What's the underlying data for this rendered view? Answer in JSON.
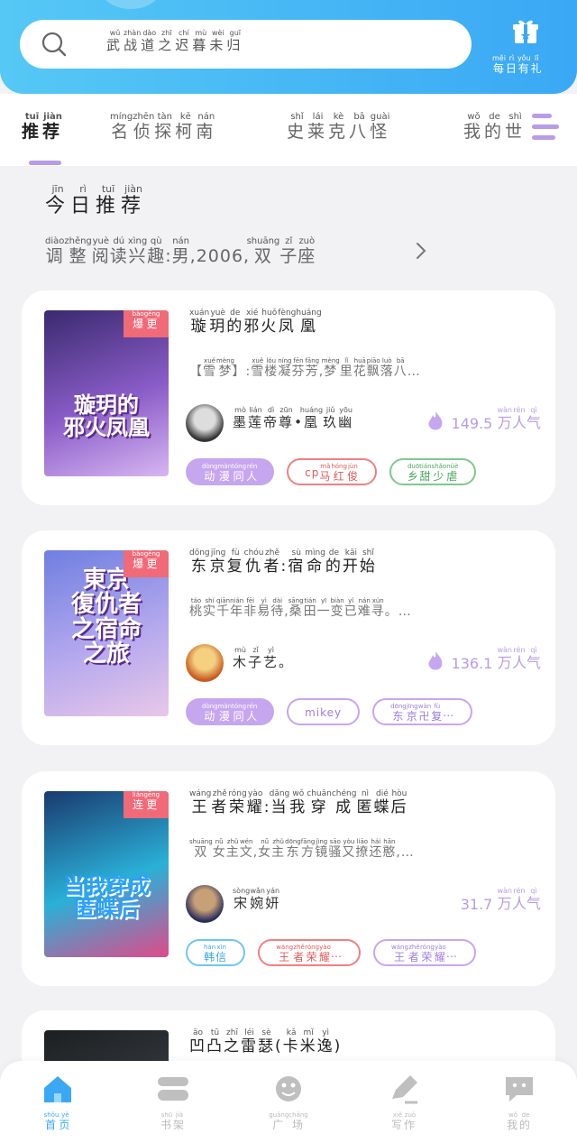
{
  "search": {
    "placeholder": [
      [
        "武",
        "wǔ"
      ],
      [
        "战",
        "zhàn"
      ],
      [
        "道",
        "dào"
      ],
      [
        "之",
        "zhī"
      ],
      [
        "迟",
        "chí"
      ],
      [
        "暮",
        "mù"
      ],
      [
        "未",
        "wèi"
      ],
      [
        "归",
        "guī"
      ]
    ]
  },
  "gift": {
    "label": [
      [
        "每",
        "měi"
      ],
      [
        "日",
        "rì"
      ],
      [
        "有",
        "yǒu"
      ],
      [
        "礼",
        "lǐ"
      ]
    ]
  },
  "tabs": [
    {
      "chars": [
        [
          "推",
          "tuī"
        ],
        [
          "荐",
          "jiàn"
        ]
      ],
      "active": true
    },
    {
      "chars": [
        [
          "名",
          "míng"
        ],
        [
          "侦",
          "zhēn"
        ],
        [
          "探",
          "tàn"
        ],
        [
          "柯",
          "kē"
        ],
        [
          "南",
          "nán"
        ]
      ],
      "active": false
    },
    {
      "chars": [
        [
          "史",
          "shǐ"
        ],
        [
          "莱",
          "lái"
        ],
        [
          "克",
          "kè"
        ],
        [
          "八",
          "bā"
        ],
        [
          "怪",
          "guài"
        ]
      ],
      "active": false
    },
    {
      "chars": [
        [
          "我",
          "wǒ"
        ],
        [
          "的",
          "de"
        ],
        [
          "世",
          "shì"
        ]
      ],
      "active": false
    }
  ],
  "recommend": {
    "title": [
      [
        "今",
        "jīn"
      ],
      [
        "日",
        "rì"
      ],
      [
        "推",
        "tuī"
      ],
      [
        "荐",
        "jiàn"
      ]
    ],
    "subtitle": [
      [
        "调",
        "diào"
      ],
      [
        "整",
        "zhěng"
      ],
      [
        "阅",
        "yuè"
      ],
      [
        "读",
        "dú"
      ],
      [
        "兴",
        "xìng"
      ],
      [
        "趣",
        "qù"
      ],
      [
        ":",
        ""
      ],
      [
        "男",
        "nán"
      ],
      [
        ",",
        ""
      ],
      [
        "2006",
        ""
      ],
      [
        ",",
        ""
      ],
      [
        "双",
        "shuāng"
      ],
      [
        "子",
        "zǐ"
      ],
      [
        "座",
        "zuò"
      ]
    ]
  },
  "books": [
    {
      "badge": [
        [
          "爆",
          "bào"
        ],
        [
          "更",
          "gēng"
        ]
      ],
      "cover_text": "璇玥的\n邪火凤凰",
      "title": [
        [
          "璇",
          "xuán"
        ],
        [
          "玥",
          "yuè"
        ],
        [
          "的",
          "de"
        ],
        [
          "邪",
          "xié"
        ],
        [
          "火",
          "huǒ"
        ],
        [
          "凤",
          "fèng"
        ],
        [
          "凰",
          "huáng"
        ]
      ],
      "desc": [
        [
          "【",
          ""
        ],
        [
          "雪",
          "xuě"
        ],
        [
          "梦",
          "mèng"
        ],
        [
          "】",
          ""
        ],
        [
          ":",
          ""
        ],
        [
          "雪",
          "xuě"
        ],
        [
          "楼",
          "lóu"
        ],
        [
          "凝",
          "níng"
        ],
        [
          "芬",
          "fēn"
        ],
        [
          "芳",
          "fāng"
        ],
        [
          ",",
          ""
        ],
        [
          "梦",
          "mèng"
        ],
        [
          "里",
          "lǐ"
        ],
        [
          "花",
          "huā"
        ],
        [
          "飘",
          "piāo"
        ],
        [
          "落",
          "luò"
        ],
        [
          "八",
          "bā"
        ],
        [
          "…",
          ""
        ]
      ],
      "author": [
        [
          "墨",
          "mò"
        ],
        [
          "莲",
          "lián"
        ],
        [
          "帝",
          "dì"
        ],
        [
          "尊",
          "zūn"
        ],
        [
          "•",
          ""
        ],
        [
          "凰",
          "huáng"
        ],
        [
          "玖",
          "jiǔ"
        ],
        [
          "幽",
          "yōu"
        ]
      ],
      "popularity_num": "149.5",
      "popularity_unit": [
        [
          "万",
          "wàn"
        ],
        [
          "人",
          "rén"
        ],
        [
          "气",
          "qì"
        ]
      ],
      "hot": true,
      "tags": [
        {
          "style": "purple-fill",
          "chars": [
            [
              "动",
              "dòng"
            ],
            [
              "漫",
              "màn"
            ],
            [
              "同",
              "tóng"
            ],
            [
              "人",
              "rén"
            ]
          ]
        },
        {
          "style": "red",
          "chars": [
            [
              "cp",
              ""
            ],
            [
              "马",
              "mǎ"
            ],
            [
              "红",
              "hóng"
            ],
            [
              "俊",
              "jùn"
            ]
          ]
        },
        {
          "style": "green",
          "chars": [
            [
              "乡",
              "duō"
            ],
            [
              "甜",
              "tián"
            ],
            [
              "少",
              "shǎo"
            ],
            [
              "虐",
              "nüè"
            ]
          ]
        }
      ],
      "colors": [
        "#3a2a6e",
        "#8a5cc8",
        "#d7b6f2"
      ]
    },
    {
      "badge": [
        [
          "爆",
          "bào"
        ],
        [
          "更",
          "gēng"
        ]
      ],
      "cover_text": "東京\n復仇者\n之宿命\n之旅",
      "title": [
        [
          "东",
          "dōng"
        ],
        [
          "京",
          "jīng"
        ],
        [
          "复",
          "fù"
        ],
        [
          "仇",
          "chóu"
        ],
        [
          "者",
          "zhě"
        ],
        [
          ":",
          ""
        ],
        [
          "宿",
          "sù"
        ],
        [
          "命",
          "mìng"
        ],
        [
          "的",
          "de"
        ],
        [
          "开",
          "kāi"
        ],
        [
          "始",
          "shǐ"
        ]
      ],
      "desc": [
        [
          "桃",
          "táo"
        ],
        [
          "实",
          "shí"
        ],
        [
          "千",
          "qiān"
        ],
        [
          "年",
          "nián"
        ],
        [
          "非",
          "fēi"
        ],
        [
          "易",
          "yì"
        ],
        [
          "待",
          "dài"
        ],
        [
          ",",
          ""
        ],
        [
          "桑",
          "sāng"
        ],
        [
          "田",
          "tián"
        ],
        [
          "一",
          "yī"
        ],
        [
          "变",
          "biàn"
        ],
        [
          "已",
          "yǐ"
        ],
        [
          "难",
          "nán"
        ],
        [
          "寻",
          "xún"
        ],
        [
          "。…",
          ""
        ]
      ],
      "author": [
        [
          "木",
          "mù"
        ],
        [
          "子",
          "zǐ"
        ],
        [
          "艺",
          "yì"
        ],
        [
          "。",
          ""
        ]
      ],
      "popularity_num": "136.1",
      "popularity_unit": [
        [
          "万",
          "wàn"
        ],
        [
          "人",
          "rén"
        ],
        [
          "气",
          "qì"
        ]
      ],
      "hot": true,
      "tags": [
        {
          "style": "purple-fill",
          "chars": [
            [
              "动",
              "dòng"
            ],
            [
              "漫",
              "màn"
            ],
            [
              "同",
              "tóng"
            ],
            [
              "人",
              "rén"
            ]
          ]
        },
        {
          "style": "purple",
          "chars": [
            [
              "mikey",
              ""
            ]
          ]
        },
        {
          "style": "purple",
          "chars": [
            [
              "东",
              "dōng"
            ],
            [
              "京",
              "jīng"
            ],
            [
              "卍",
              "wàn"
            ],
            [
              "复",
              "fù"
            ],
            [
              "…",
              ""
            ]
          ]
        }
      ],
      "colors": [
        "#6f7fe0",
        "#b4a8ee",
        "#e8c8e8"
      ]
    },
    {
      "badge": [
        [
          "连",
          "lián"
        ],
        [
          "更",
          "gēng"
        ]
      ],
      "cover_text": "当我穿成\n匿蝶后",
      "title": [
        [
          "王",
          "wáng"
        ],
        [
          "者",
          "zhě"
        ],
        [
          "荣",
          "róng"
        ],
        [
          "耀",
          "yào"
        ],
        [
          ":",
          ""
        ],
        [
          "当",
          "dāng"
        ],
        [
          "我",
          "wǒ"
        ],
        [
          "穿",
          "chuān"
        ],
        [
          "成",
          "chéng"
        ],
        [
          "匿",
          "nì"
        ],
        [
          "蝶",
          "dié"
        ],
        [
          "后",
          "hòu"
        ]
      ],
      "desc": [
        [
          "双",
          "shuāng"
        ],
        [
          "女",
          "nǚ"
        ],
        [
          "主",
          "zhǔ"
        ],
        [
          "文",
          "wén"
        ],
        [
          ",",
          ""
        ],
        [
          "女",
          "nǚ"
        ],
        [
          "主",
          "zhǔ"
        ],
        [
          "东",
          "dōng"
        ],
        [
          "方",
          "fāng"
        ],
        [
          "镜",
          "jìng"
        ],
        [
          "骚",
          "sāo"
        ],
        [
          "又",
          "yòu"
        ],
        [
          "撩",
          "liāo"
        ],
        [
          "还",
          "hái"
        ],
        [
          "憨",
          "hān"
        ],
        [
          ",…",
          ""
        ]
      ],
      "author": [
        [
          "宋",
          "sòng"
        ],
        [
          "婉",
          "wǎn"
        ],
        [
          "妍",
          "yán"
        ]
      ],
      "popularity_num": "31.7",
      "popularity_unit": [
        [
          "万",
          "wàn"
        ],
        [
          "人",
          "rén"
        ],
        [
          "气",
          "qì"
        ]
      ],
      "hot": false,
      "tags": [
        {
          "style": "blue",
          "chars": [
            [
              "韩",
              "hán"
            ],
            [
              "信",
              "xìn"
            ]
          ]
        },
        {
          "style": "red",
          "chars": [
            [
              "王",
              "wáng"
            ],
            [
              "者",
              "zhě"
            ],
            [
              "荣",
              "róng"
            ],
            [
              "耀",
              "yào"
            ],
            [
              "…",
              ""
            ]
          ]
        },
        {
          "style": "purple",
          "chars": [
            [
              "王",
              "wáng"
            ],
            [
              "者",
              "zhě"
            ],
            [
              "荣",
              "róng"
            ],
            [
              "耀",
              "yào"
            ],
            [
              "…",
              ""
            ]
          ]
        }
      ],
      "colors": [
        "#1a3a6e",
        "#2ab0d8",
        "#e04a8a"
      ]
    },
    {
      "badge": [],
      "cover_text": "",
      "title": [
        [
          "凹",
          "āo"
        ],
        [
          "凸",
          "tū"
        ],
        [
          "之",
          "zhī"
        ],
        [
          "雷",
          "léi"
        ],
        [
          "瑟",
          "sè"
        ],
        [
          "(",
          ""
        ],
        [
          "卡",
          "kǎ"
        ],
        [
          "米",
          "mǐ"
        ],
        [
          "逸",
          "yì"
        ],
        [
          ")",
          ""
        ]
      ],
      "desc": [],
      "author": [],
      "popularity_num": "",
      "popularity_unit": [],
      "hot": false,
      "tags": [],
      "colors": [
        "#1c1f22",
        "#3a3f44",
        "#5a6066"
      ]
    }
  ],
  "nav": [
    {
      "chars": [
        [
          "首",
          "shǒu"
        ],
        [
          "页",
          "yè"
        ]
      ],
      "icon": "home-icon",
      "active": true
    },
    {
      "chars": [
        [
          "书",
          "shū"
        ],
        [
          "架",
          "jià"
        ]
      ],
      "icon": "bookshelf-icon",
      "active": false
    },
    {
      "chars": [
        [
          "广",
          "guǎng"
        ],
        [
          "场",
          "chǎng"
        ]
      ],
      "icon": "planet-icon",
      "active": false
    },
    {
      "chars": [
        [
          "写",
          "xiě"
        ],
        [
          "作",
          "zuò"
        ]
      ],
      "icon": "pen-icon",
      "active": false
    },
    {
      "chars": [
        [
          "我",
          "wǒ"
        ],
        [
          "的",
          "de"
        ]
      ],
      "icon": "profile-chat-icon",
      "active": false
    }
  ],
  "colors": {
    "accent": "#3aa8f5",
    "tab_accent": "#b99ce8",
    "badge": "#f06a78"
  }
}
